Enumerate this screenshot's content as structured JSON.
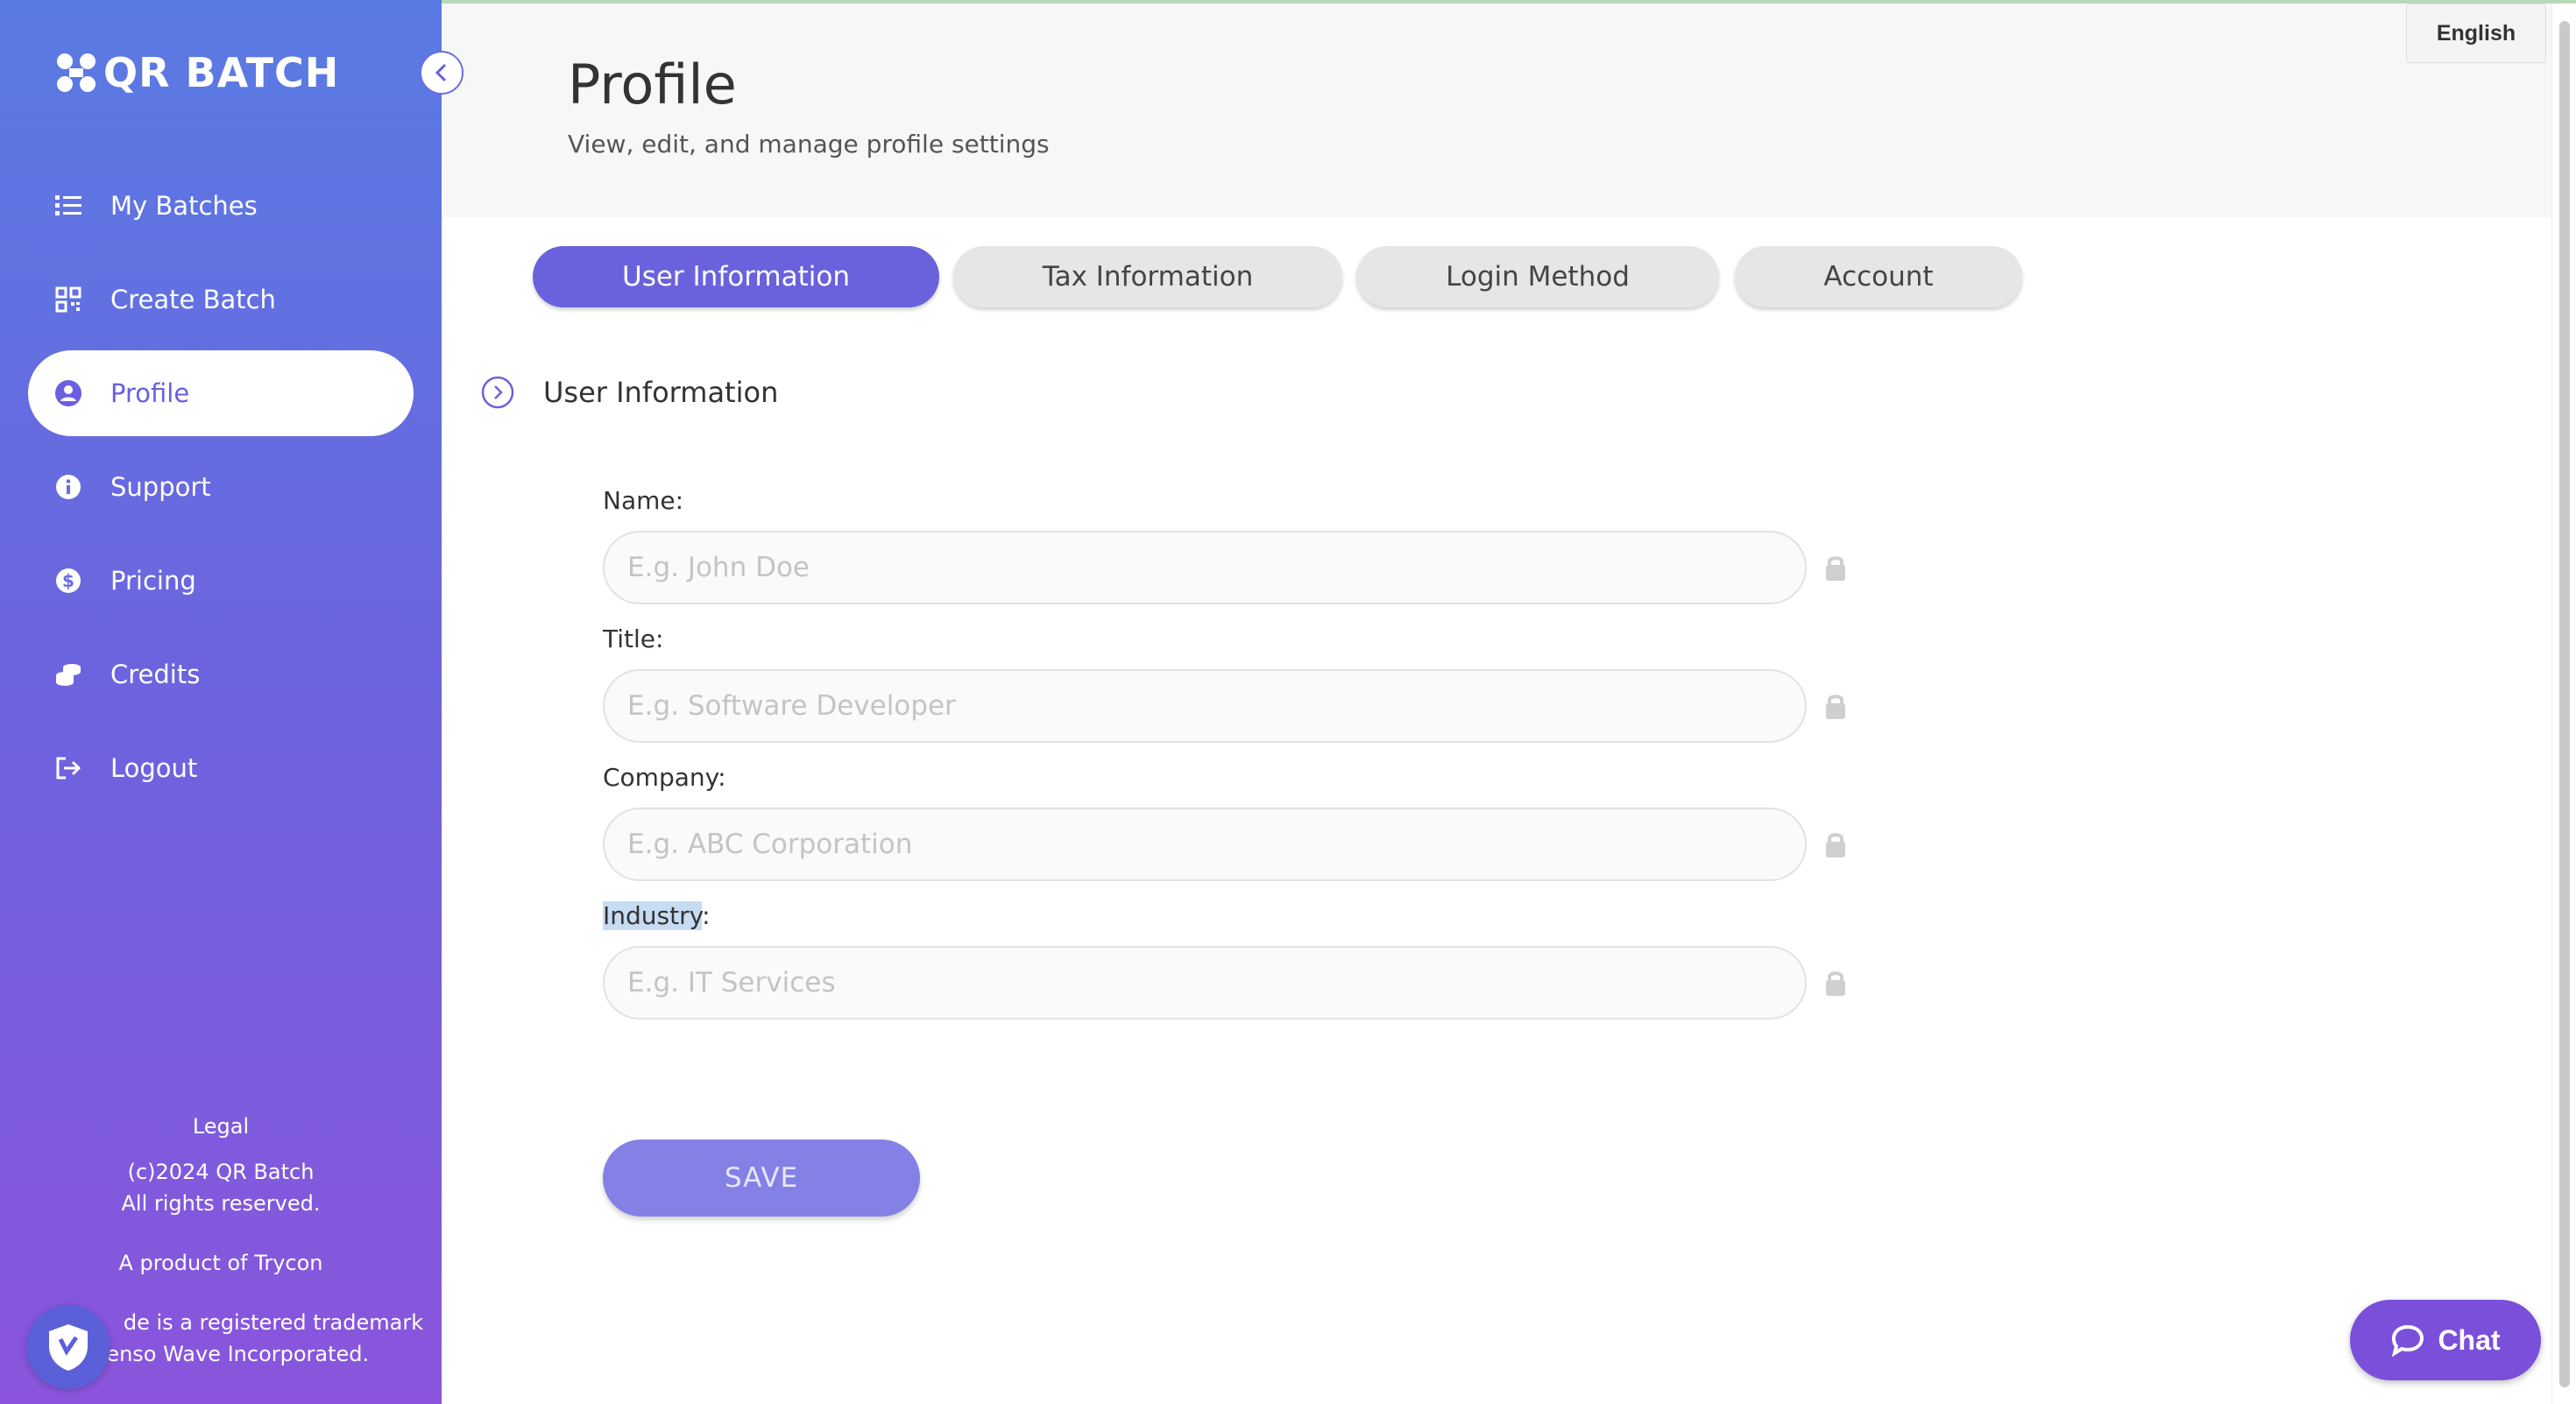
{
  "brand": {
    "name": "QR BATCH"
  },
  "sidebar": {
    "items": [
      {
        "label": "My Batches",
        "icon": "list-icon"
      },
      {
        "label": "Create Batch",
        "icon": "qr-code-icon"
      },
      {
        "label": "Profile",
        "icon": "user-circle-icon",
        "active": true
      },
      {
        "label": "Support",
        "icon": "info-icon"
      },
      {
        "label": "Pricing",
        "icon": "dollar-icon"
      },
      {
        "label": "Credits",
        "icon": "coins-icon"
      },
      {
        "label": "Logout",
        "icon": "logout-icon"
      }
    ],
    "footer": {
      "legal": "Legal",
      "copyright_line1": "(c)2024 QR Batch",
      "copyright_line2": "All rights reserved.",
      "product": "A product of Trycon",
      "trademark_line1": "de is a registered trademark",
      "trademark_line2": "Denso Wave Incorporated."
    }
  },
  "header": {
    "title": "Profile",
    "subtitle": "View, edit, and manage profile settings",
    "language": "English"
  },
  "tabs": [
    {
      "label": "User Information",
      "active": true
    },
    {
      "label": "Tax Information"
    },
    {
      "label": "Login Method"
    },
    {
      "label": "Account"
    }
  ],
  "section": {
    "title": "User Information"
  },
  "form": {
    "name": {
      "label": "Name:",
      "placeholder": "E.g. John Doe",
      "value": ""
    },
    "title": {
      "label": "Title:",
      "placeholder": "E.g. Software Developer",
      "value": ""
    },
    "company": {
      "label": "Company:",
      "placeholder": "E.g. ABC Corporation",
      "value": ""
    },
    "industry": {
      "label_highlighted": "Industry",
      "label_rest": ":",
      "placeholder": "E.g. IT Services",
      "value": ""
    },
    "save_label": "SAVE"
  },
  "chat": {
    "label": "Chat"
  },
  "colors": {
    "accent": "#6a62dd",
    "sidebar_top": "#5a7be3",
    "sidebar_bottom": "#8a55dc",
    "chat": "#7a4fd9"
  }
}
